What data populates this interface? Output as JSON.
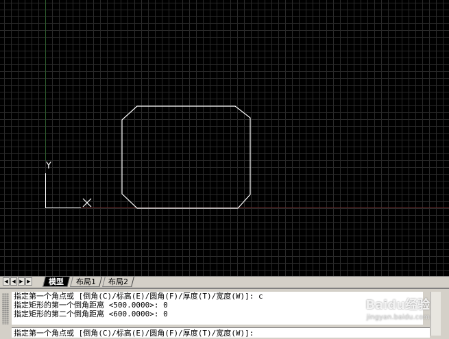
{
  "drawing": {
    "ucs_y_label": "Y",
    "ucs_x_label": "X"
  },
  "tabs": {
    "nav_buttons": [
      "first-icon",
      "prev-icon",
      "next-icon",
      "last-icon"
    ],
    "items": [
      {
        "label": "模型",
        "active": true
      },
      {
        "label": "布局1",
        "active": false
      },
      {
        "label": "布局2",
        "active": false
      }
    ]
  },
  "command": {
    "history": [
      "指定第一个角点或 [倒角(C)/标高(E)/圆角(F)/厚度(T)/宽度(W)]: c",
      "指定矩形的第一个倒角距离 <500.0000>: 0",
      "指定矩形的第二个倒角距离 <600.0000>: 0"
    ],
    "prompt": "指定第一个角点或 [倒角(C)/标高(E)/圆角(F)/厚度(T)/宽度(W)]:"
  },
  "watermark": {
    "brand": "Baidu经验",
    "url": "jingyan.baidu.com"
  },
  "colors": {
    "canvas": "#000000",
    "grid": "#2a2a2a",
    "geometry": "#ffffff",
    "x_axis_line": "#6b2a2a",
    "y_axis_line": "#2c5a2c"
  }
}
